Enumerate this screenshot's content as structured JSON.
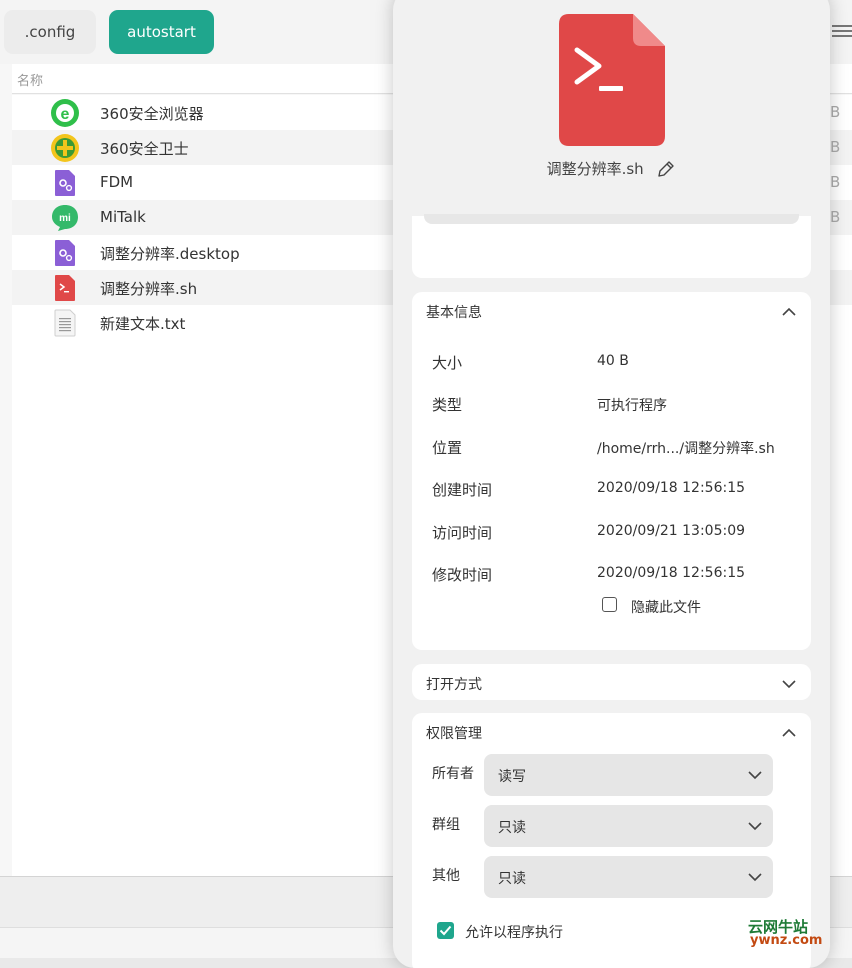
{
  "breadcrumbs": [
    {
      "label": ".config",
      "active": false
    },
    {
      "label": "autostart",
      "active": true
    }
  ],
  "list_header": {
    "name_col": "名称"
  },
  "files": [
    {
      "name": "360安全浏览器",
      "icon": "browser-360-icon",
      "size": "B"
    },
    {
      "name": "360安全卫士",
      "icon": "security-360-icon",
      "size": "B"
    },
    {
      "name": "FDM",
      "icon": "desktop-file-icon",
      "size": "B"
    },
    {
      "name": "MiTalk",
      "icon": "mitalk-icon",
      "size": "B"
    },
    {
      "name": "调整分辨率.desktop",
      "icon": "desktop-file-icon",
      "size": ""
    },
    {
      "name": "调整分辨率.sh",
      "icon": "shell-script-icon",
      "size": ""
    },
    {
      "name": "新建文本.txt",
      "icon": "text-file-icon",
      "size": ""
    }
  ],
  "dialog": {
    "file_name": "调整分辨率.sh",
    "file_icon": "terminal-script-icon",
    "basic_info": {
      "title": "基本信息",
      "rows": [
        {
          "key": "大小",
          "value": "40 B"
        },
        {
          "key": "类型",
          "value": "可执行程序"
        },
        {
          "key": "位置",
          "value": "/home/rrh.../调整分辨率.sh"
        },
        {
          "key": "创建时间",
          "value": "2020/09/18 12:56:15"
        },
        {
          "key": "访问时间",
          "value": "2020/09/21 13:05:09"
        },
        {
          "key": "修改时间",
          "value": "2020/09/18 12:56:15"
        }
      ],
      "hide_file_label": "隐藏此文件",
      "hide_file_checked": false
    },
    "open_with": {
      "title": "打开方式"
    },
    "permissions": {
      "title": "权限管理",
      "rows": [
        {
          "key": "所有者",
          "value": "读写"
        },
        {
          "key": "群组",
          "value": "只读"
        },
        {
          "key": "其他",
          "value": "只读"
        }
      ],
      "exec_label": "允许以程序执行",
      "exec_checked": true
    }
  },
  "watermark": {
    "line1": "云网牛站",
    "line2": "ywnz.com"
  },
  "colors": {
    "accent": "#1fa68d",
    "script_red": "#e04848"
  }
}
